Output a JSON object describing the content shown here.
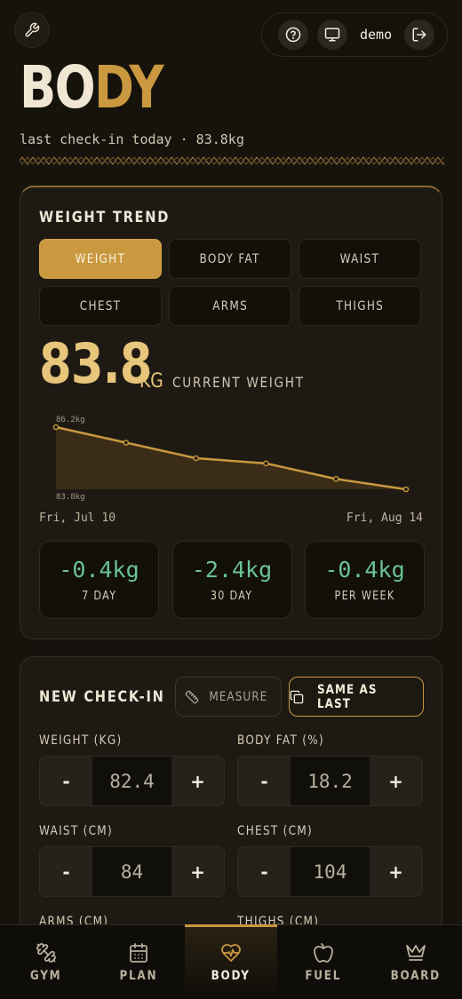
{
  "header": {
    "user_name": "demo",
    "logo_part1": "BO",
    "logo_part2": "DY",
    "subtitle": "last check-in today · 83.8kg"
  },
  "trend": {
    "title": "WEIGHT TREND",
    "tabs": [
      {
        "label": "WEIGHT",
        "active": true
      },
      {
        "label": "BODY FAT",
        "active": false
      },
      {
        "label": "WAIST",
        "active": false
      },
      {
        "label": "CHEST",
        "active": false
      },
      {
        "label": "ARMS",
        "active": false
      },
      {
        "label": "THIGHS",
        "active": false
      }
    ],
    "current_value": "83.8",
    "current_unit": "KG",
    "current_label": "CURRENT WEIGHT",
    "start_date": "Fri, Jul 10",
    "end_date": "Fri, Aug 14",
    "stats": [
      {
        "value": "-0.4kg",
        "label": "7 DAY"
      },
      {
        "value": "-2.4kg",
        "label": "30 DAY"
      },
      {
        "value": "-0.4kg",
        "label": "PER WEEK"
      }
    ]
  },
  "chart_data": {
    "type": "area",
    "max_label": "86.2kg",
    "min_label": "83.8kg",
    "x": [
      "Fri, Jul 10",
      "",
      "",
      "",
      "",
      "Fri, Aug 14"
    ],
    "values": [
      86.2,
      85.6,
      85.0,
      84.8,
      84.2,
      83.8
    ],
    "ylim": [
      83.8,
      86.2
    ],
    "colors": {
      "line": "#c9983f",
      "fill": "#3a2c16"
    }
  },
  "checkin": {
    "title": "NEW CHECK-IN",
    "measure_label": "MEASURE",
    "same_label": "SAME AS LAST",
    "fields": [
      {
        "label": "WEIGHT (KG)",
        "value": "82.4"
      },
      {
        "label": "BODY FAT (%)",
        "value": "18.2"
      },
      {
        "label": "WAIST (CM)",
        "value": "84"
      },
      {
        "label": "CHEST (CM)",
        "value": "104"
      },
      {
        "label": "ARMS (CM)",
        "value": ""
      },
      {
        "label": "THIGHS (CM)",
        "value": ""
      }
    ],
    "minus": "-",
    "plus": "+"
  },
  "nav": [
    {
      "label": "GYM",
      "icon": "dumbbell-icon",
      "active": false
    },
    {
      "label": "PLAN",
      "icon": "calendar-icon",
      "active": false
    },
    {
      "label": "BODY",
      "icon": "heart-pulse-icon",
      "active": true
    },
    {
      "label": "FUEL",
      "icon": "apple-icon",
      "active": false
    },
    {
      "label": "BOARD",
      "icon": "crown-icon",
      "active": false
    }
  ],
  "colors": {
    "accent": "#c9983f",
    "positive": "#6bc394",
    "background": "#16130d"
  }
}
